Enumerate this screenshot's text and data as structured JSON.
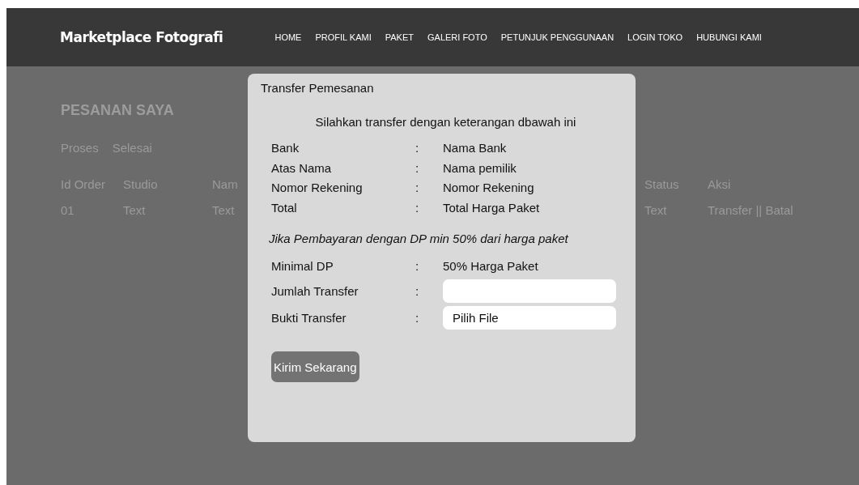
{
  "header": {
    "logo": "Marketplace Fotografi",
    "nav": [
      "HOME",
      "PROFIL KAMI",
      "PAKET",
      "GALERI FOTO",
      "PETUNJUK PENGGUNAAN",
      "LOGIN TOKO",
      "HUBUNGI KAMI"
    ]
  },
  "page": {
    "title": "PESANAN SAYA",
    "tabs": [
      {
        "label": "Proses"
      },
      {
        "label": "Selesai"
      }
    ],
    "table": {
      "columns": [
        "Id Order",
        "Studio",
        "Nam",
        "Status",
        "Aksi"
      ],
      "rows": [
        [
          "01",
          "Text",
          "Text",
          "Text",
          "Transfer || Batal"
        ]
      ]
    }
  },
  "modal": {
    "title": "Transfer Pemesanan",
    "intro": "Silahkan transfer dengan keterangan dbawah ini",
    "details": [
      {
        "label": "Bank",
        "value": "Nama Bank"
      },
      {
        "label": "Atas Nama",
        "value": "Nama pemilik"
      },
      {
        "label": "Nomor Rekening",
        "value": "Nomor Rekening"
      },
      {
        "label": "Total",
        "value": "Total Harga Paket"
      }
    ],
    "note": "Jika Pembayaran dengan DP min 50% dari harga paket",
    "form": [
      {
        "kind": "text",
        "label": "Minimal DP",
        "value": "50% Harga Paket"
      },
      {
        "kind": "input",
        "label": "Jumlah Transfer"
      },
      {
        "kind": "file",
        "label": "Bukti Transfer",
        "value": "Pilih File"
      }
    ],
    "separator": ":",
    "submit": "Kirim Sekarang"
  }
}
